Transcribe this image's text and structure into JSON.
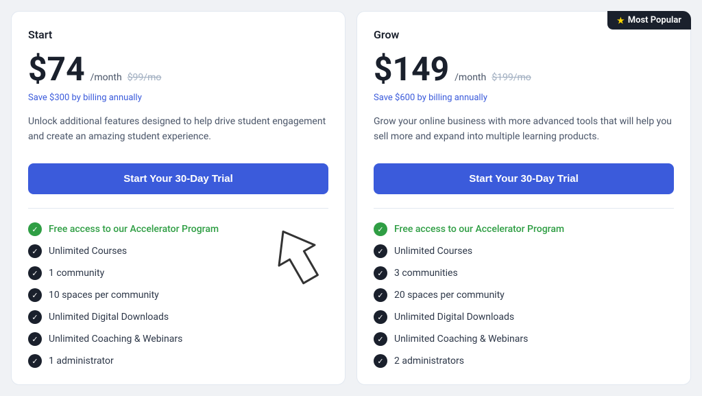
{
  "plans": [
    {
      "id": "start",
      "name": "Start",
      "price": "$74",
      "period": "/month",
      "original_price": "$99/mo",
      "save_text": "Save $300 by billing annually",
      "description": "Unlock additional features designed to help drive student engagement and create an amazing student experience.",
      "trial_button": "Start Your 30-Day Trial",
      "features": [
        {
          "text": "Free access to our Accelerator Program",
          "type": "highlight"
        },
        {
          "text": "Unlimited Courses",
          "type": "dark"
        },
        {
          "text": "1 community",
          "type": "dark"
        },
        {
          "text": "10 spaces per community",
          "type": "dark"
        },
        {
          "text": "Unlimited Digital Downloads",
          "type": "dark"
        },
        {
          "text": "Unlimited Coaching & Webinars",
          "type": "dark"
        },
        {
          "text": "1 administrator",
          "type": "dark"
        }
      ]
    },
    {
      "id": "grow",
      "name": "Grow",
      "price": "$149",
      "period": "/month",
      "original_price": "$199/mo",
      "save_text": "Save $600 by billing annually",
      "description": "Grow your online business with more advanced tools that will help you sell more and expand into multiple learning products.",
      "trial_button": "Start Your 30-Day Trial",
      "badge": "★ Most Popular",
      "features": [
        {
          "text": "Free access to our Accelerator Program",
          "type": "highlight"
        },
        {
          "text": "Unlimited Courses",
          "type": "dark"
        },
        {
          "text": "3 communities",
          "type": "dark"
        },
        {
          "text": "20 spaces per community",
          "type": "dark"
        },
        {
          "text": "Unlimited Digital Downloads",
          "type": "dark"
        },
        {
          "text": "Unlimited Coaching & Webinars",
          "type": "dark"
        },
        {
          "text": "2 administrators",
          "type": "dark"
        }
      ]
    }
  ],
  "most_popular_label": "Most Popular"
}
